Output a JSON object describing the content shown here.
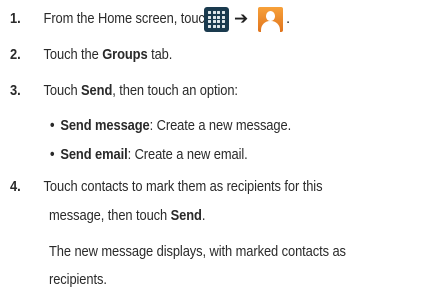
{
  "steps": [
    {
      "number": "1.",
      "text": "From the Home screen, touch",
      "icons": [
        "apps-grid-icon",
        "right-arrow-icon",
        "contacts-icon"
      ],
      "arrow": "➔",
      "end": "."
    },
    {
      "number": "2.",
      "pre": "Touch the ",
      "bold": "Groups",
      "post": " tab."
    },
    {
      "number": "3.",
      "pre": "Touch ",
      "bold": "Send",
      "post": ", then touch an option:",
      "options": [
        {
          "bullet": "•",
          "bold": "Send message",
          "text": ": Create a new message."
        },
        {
          "bullet": "•",
          "bold": "Send email",
          "text": ": Create a new email."
        }
      ]
    },
    {
      "number": "4.",
      "line1": "Touch contacts to mark them as recipients for this",
      "line2_pre": "message, then touch ",
      "line2_bold": "Send",
      "line2_post": ".",
      "note_line1": "The new message displays, with marked contacts as",
      "note_line2": "recipients."
    }
  ],
  "colors": {
    "text": "#2a2a2a",
    "apps_icon_bg": "#1a3a4e",
    "contacts_icon_bg": "#e8862b"
  }
}
